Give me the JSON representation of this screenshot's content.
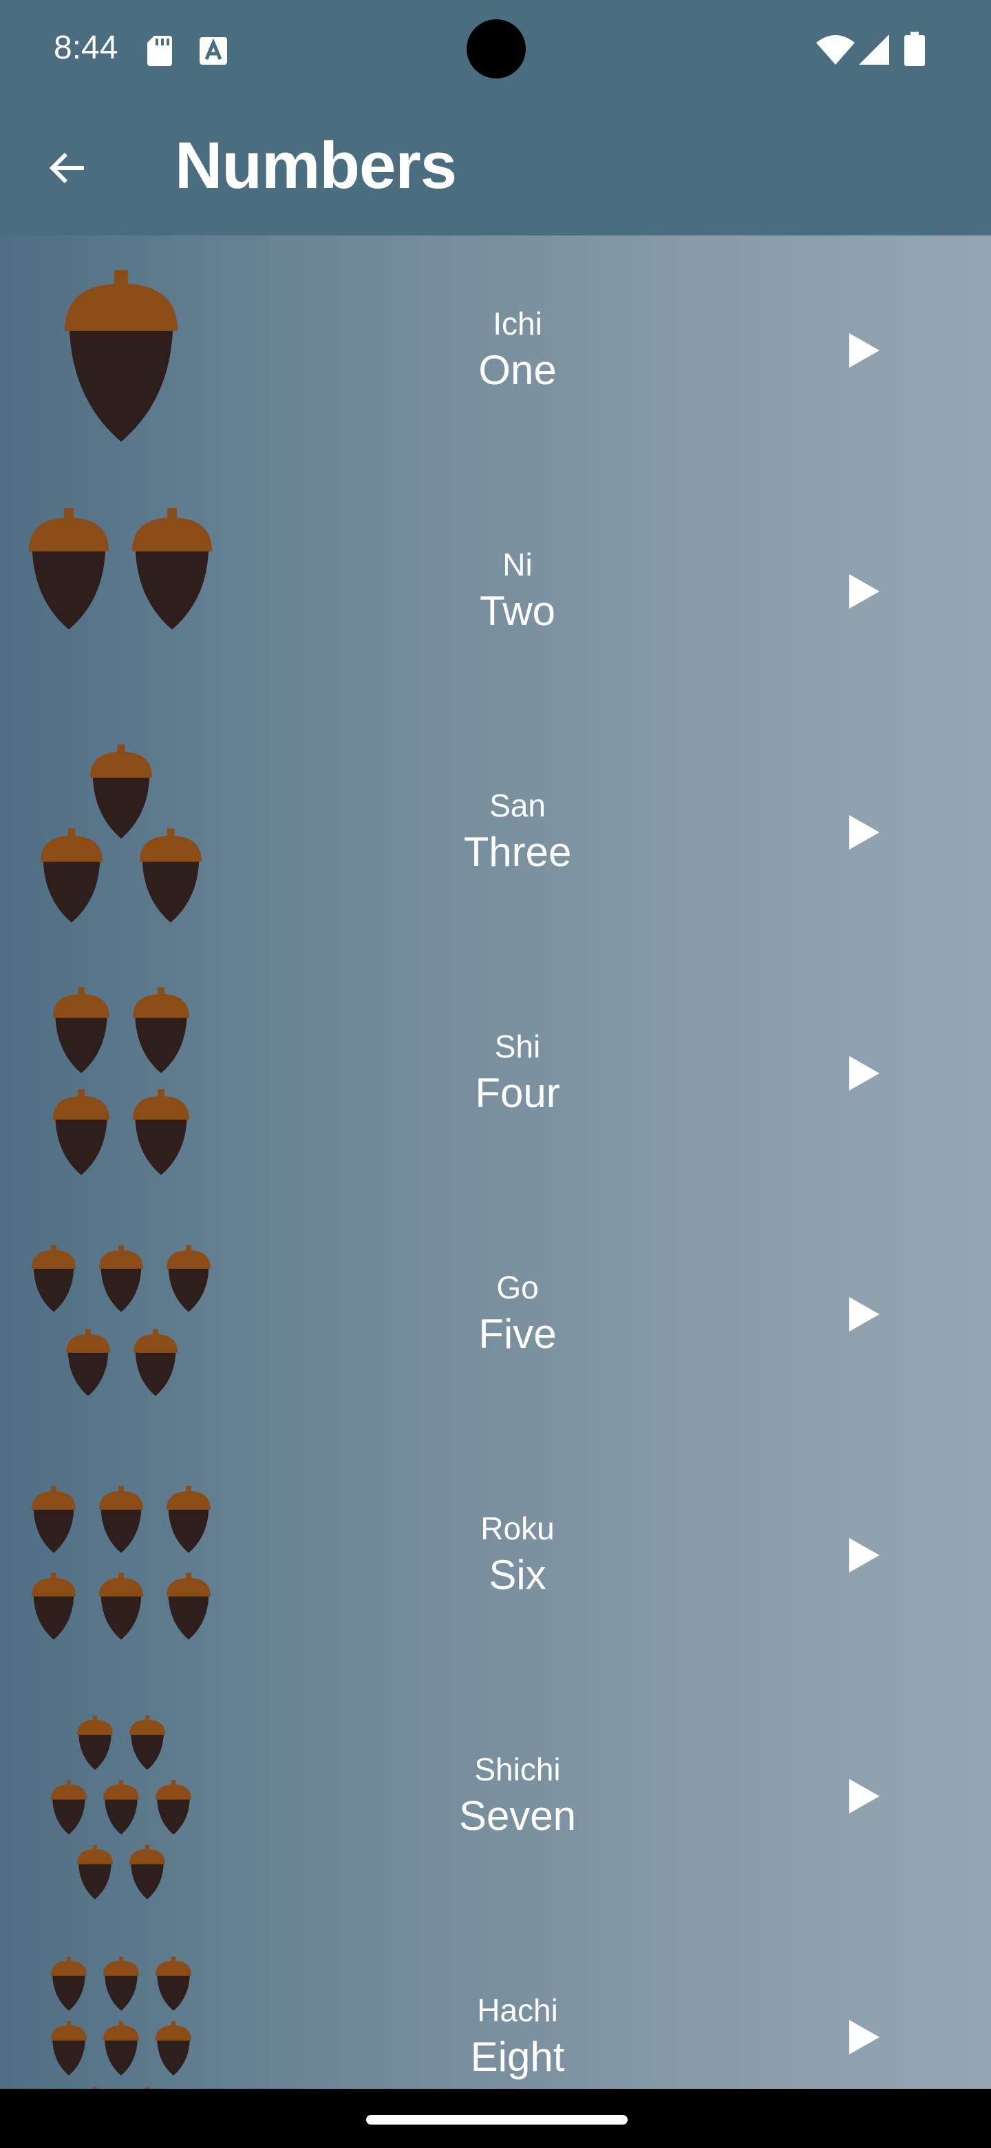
{
  "status_bar": {
    "time": "8:44",
    "icons": [
      "sd-card-icon",
      "keyboard-a-icon",
      "wifi-icon",
      "signal-icon",
      "battery-icon"
    ]
  },
  "app_bar": {
    "title": "Numbers",
    "back_icon": "arrow-back-icon"
  },
  "colors": {
    "header": "#4b6d80",
    "acorn_cap": "#8b4c16",
    "acorn_body": "#2e1e1c",
    "text": "#ffffff"
  },
  "numbers": [
    {
      "japanese": "Ichi",
      "english": "One",
      "count": 1
    },
    {
      "japanese": "Ni",
      "english": "Two",
      "count": 2
    },
    {
      "japanese": "San",
      "english": "Three",
      "count": 3
    },
    {
      "japanese": "Shi",
      "english": "Four",
      "count": 4
    },
    {
      "japanese": "Go",
      "english": "Five",
      "count": 5
    },
    {
      "japanese": "Roku",
      "english": "Six",
      "count": 6
    },
    {
      "japanese": "Shichi",
      "english": "Seven",
      "count": 7
    },
    {
      "japanese": "Hachi",
      "english": "Eight",
      "count": 8
    }
  ]
}
